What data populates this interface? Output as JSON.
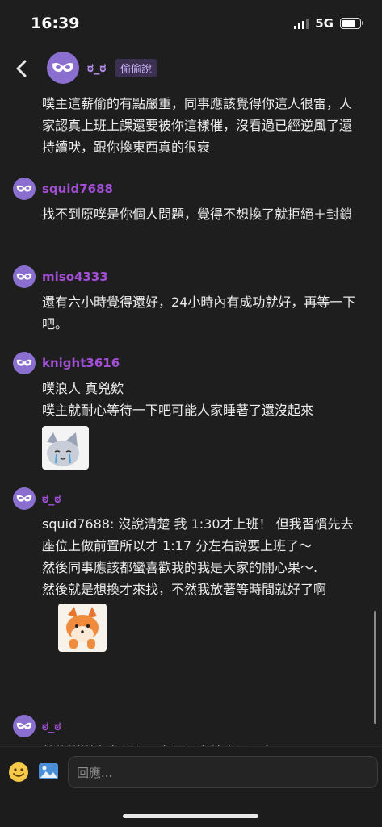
{
  "status_bar": {
    "time": "16:39",
    "network": "5G"
  },
  "header": {
    "author": "ಠ_ಠ",
    "board": "偷偷說"
  },
  "comments": [
    {
      "author": "",
      "lines": [
        "噗主這薪偷的有點嚴重，同事應該覺得你這人很雷，人家認真上班上課還要被你這樣催，沒看過已經逆風了還持續吠，跟你換東西真的很衰"
      ]
    },
    {
      "author": "squid7688",
      "lines": [
        "找不到原噗是你個人問題，覺得不想換了就拒絕＋封鎖"
      ]
    },
    {
      "author": "miso4333",
      "lines": [
        "還有六小時覺得還好，24小時內有成功就好，再等一下吧。"
      ]
    },
    {
      "author": "knight3616",
      "lines": [
        "噗浪人 真兇欸",
        "噗主就耐心等待一下吧可能人家睡著了還沒起來"
      ],
      "sticker": "crying-cat-sticker"
    },
    {
      "author": "ಠ_ಠ",
      "lines": [
        "squid7688: 沒說清楚 我 1:30才上班！ 但我習慣先去座位上做前置所以才 1:17 分左右說要上班了～",
        "然後同事應該都蠻喜歡我的我是大家的開心果～.",
        "然後就是想換才來找，不然我放著等時間就好了啊"
      ],
      "sticker": "fox-sticker"
    },
    {
      "author": "ಠ_ಠ",
      "lines": [
        "然後謝謝大家關心，交易平安結束了 🦯"
      ]
    }
  ],
  "composer": {
    "placeholder": "回應..."
  },
  "colors": {
    "background": "#1e1e1e",
    "author": "#a24ed6",
    "avatar": "#8a6fd0",
    "text": "#ececec"
  },
  "icons": [
    "back-chevron-icon",
    "mask-avatar-icon",
    "emoji-icon",
    "image-icon",
    "signal-icon",
    "battery-icon"
  ]
}
